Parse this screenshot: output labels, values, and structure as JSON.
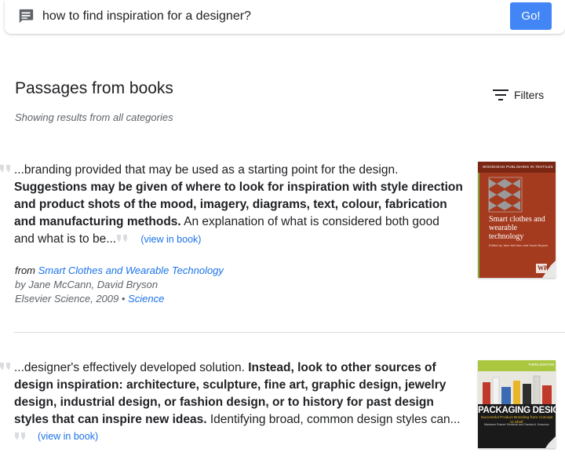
{
  "search": {
    "query": "how to find inspiration for a designer?",
    "go_label": "Go!"
  },
  "section": {
    "title": "Passages from books",
    "subtitle": "Showing results from all categories",
    "filters_label": "Filters"
  },
  "results": [
    {
      "passage_lead": "...branding provided that may be used as a starting point for the design. ",
      "passage_bold": "Suggestions may be given of where to look for inspiration with style direction and product shots of the mood, imagery, diagrams, text, colour, fabrication and manufacturing methods.",
      "passage_tail": " An explanation of what is considered both good and what is to be...",
      "view_link": "(view in book)",
      "from_label": "from",
      "book_title": "Smart Clothes and Wearable Technology",
      "authors": "by Jane McCann, David Bryson",
      "publisher_year": "Elsevier Science, 2009",
      "separator": "•",
      "category": "Science",
      "cover": {
        "series_text": "WOODHEAD PUBLISHING IN TEXTILES",
        "title_text": "Smart clothes and wearable technology",
        "editors_text": "Edited by Jane McCann and David Bryson",
        "publisher_mark": "WP",
        "colors": {
          "background": "#a43a1e",
          "band": "#7a2612",
          "pattern": "#9a9a9a",
          "text": "#ffffff",
          "border": "#86a83a"
        }
      }
    },
    {
      "passage_lead": "...designer's effectively developed solution. ",
      "passage_bold": "Instead, look to other sources of design inspiration: architecture, sculpture, fine art, graphic design, jewelry design, industrial design, or fashion design, or to history for past design styles that can inspire new ideas.",
      "passage_tail": " Identifying broad, common design styles can...",
      "view_link": "(view in book)",
      "cover": {
        "series_text": "THIRD EDITION",
        "title_text": "PACKAGING DESIGN",
        "subtitle_text": "Successful Product Branding from Concept to Shelf",
        "author_text": "Marianne Rosner Klimchuk and Sandra A. Krasovec",
        "colors": {
          "top": "#a9c840",
          "band": "#1a1a1a",
          "title": "#ffffff",
          "subtitle": "#e9b62a"
        }
      }
    }
  ],
  "colors": {
    "accent": "#4285f4",
    "link": "#1a73e8",
    "muted": "#5f6368",
    "divider": "#dadce0"
  }
}
